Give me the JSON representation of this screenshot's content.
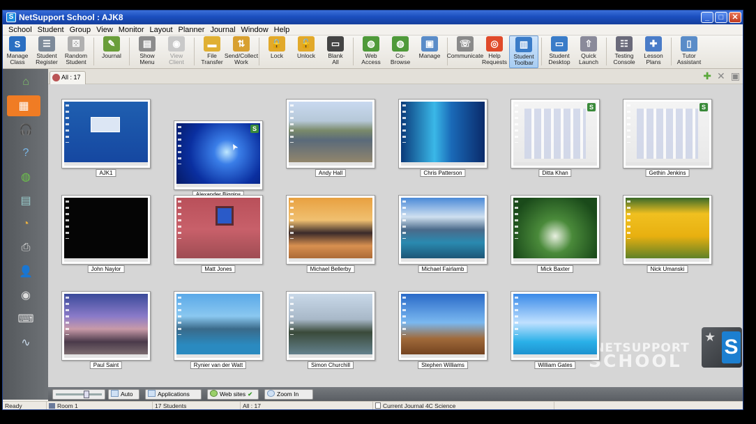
{
  "window": {
    "title": "NetSupport School : AJK8",
    "app_icon": "netsupport-app-icon"
  },
  "menu": [
    "School",
    "Student",
    "Group",
    "View",
    "Monitor",
    "Layout",
    "Planner",
    "Journal",
    "Window",
    "Help"
  ],
  "toolbar": [
    {
      "id": "manage-class",
      "label": "Manage\nClass",
      "icon": "manage-class-icon",
      "color": "#2b6fc2",
      "glyph": "S"
    },
    {
      "id": "student-register",
      "label": "Student\nRegister",
      "icon": "student-register-icon",
      "color": "#7d8a99",
      "glyph": "☰"
    },
    {
      "id": "random-student",
      "label": "Random\nStudent",
      "icon": "dice-icon",
      "color": "#b0b0b0",
      "glyph": "⚄"
    },
    {
      "sep": true
    },
    {
      "id": "journal",
      "label": "Journal",
      "icon": "journal-icon",
      "color": "#6a9e3a",
      "glyph": "✎"
    },
    {
      "sep": true
    },
    {
      "id": "show-menu",
      "label": "Show\nMenu",
      "icon": "show-menu-icon",
      "color": "#8c8c8c",
      "glyph": "▤"
    },
    {
      "id": "view-client",
      "label": "View\nClient",
      "icon": "view-client-icon",
      "color": "#c9c9c9",
      "glyph": "◉",
      "disabled": true
    },
    {
      "sep": true
    },
    {
      "id": "file-transfer",
      "label": "File\nTransfer",
      "icon": "folder-icon",
      "color": "#e0b033",
      "glyph": "▬"
    },
    {
      "id": "send-collect",
      "label": "Send/Collect\nWork",
      "icon": "send-collect-icon",
      "color": "#d8a030",
      "glyph": "⇅"
    },
    {
      "sep": true
    },
    {
      "id": "lock",
      "label": "Lock",
      "icon": "lock-icon",
      "color": "#e2a92a",
      "glyph": "🔒"
    },
    {
      "id": "unlock",
      "label": "Unlock",
      "icon": "unlock-icon",
      "color": "#e2a92a",
      "glyph": "🔓"
    },
    {
      "id": "blank-all",
      "label": "Blank\nAll",
      "icon": "monitor-icon",
      "color": "#444",
      "glyph": "▭"
    },
    {
      "sep": true
    },
    {
      "id": "web-access",
      "label": "Web\nAccess",
      "icon": "globe-icon",
      "color": "#4f9a3a",
      "glyph": "◍"
    },
    {
      "id": "co-browse",
      "label": "Co-Browse",
      "icon": "co-browse-icon",
      "color": "#4f9a3a",
      "glyph": "◍"
    },
    {
      "id": "manage",
      "label": "Manage",
      "icon": "manage-icon",
      "color": "#5a8cc8",
      "glyph": "▣"
    },
    {
      "sep": true
    },
    {
      "id": "communicate",
      "label": "Communicate",
      "icon": "communicate-icon",
      "color": "#8a8a8a",
      "glyph": "☏"
    },
    {
      "id": "help-requests",
      "label": "Help\nRequests",
      "icon": "lifebuoy-icon",
      "color": "#e04a2a",
      "glyph": "◎"
    },
    {
      "id": "student-toolbar",
      "label": "Student\nToolbar",
      "icon": "student-toolbar-icon",
      "color": "#3a7cc8",
      "glyph": "▥",
      "selected": true
    },
    {
      "sep": true
    },
    {
      "id": "student-desktop",
      "label": "Student\nDesktop",
      "icon": "student-desktop-icon",
      "color": "#3a7cc8",
      "glyph": "▭"
    },
    {
      "id": "quick-launch",
      "label": "Quick\nLaunch",
      "icon": "rocket-icon",
      "color": "#8a8a9a",
      "glyph": "⇧"
    },
    {
      "sep": true
    },
    {
      "id": "testing-console",
      "label": "Testing\nConsole",
      "icon": "testing-console-icon",
      "color": "#6a6a7a",
      "glyph": "☷"
    },
    {
      "id": "lesson-plans",
      "label": "Lesson\nPlans",
      "icon": "puzzle-icon",
      "color": "#4a7cc8",
      "glyph": "✚"
    },
    {
      "sep": true
    },
    {
      "id": "tutor-assistant",
      "label": "Tutor\nAssistant",
      "icon": "tutor-assistant-icon",
      "color": "#5a8cc8",
      "glyph": "▯"
    }
  ],
  "sidebar": [
    {
      "id": "home",
      "icon": "home-icon",
      "glyph": "⌂",
      "color": "#7ec26a"
    },
    {
      "id": "thumbnails",
      "icon": "thumbnail-view-icon",
      "glyph": "▦",
      "color": "#fff",
      "selected": true
    },
    {
      "id": "audio",
      "icon": "headphones-icon",
      "glyph": "🎧",
      "color": "#ddd"
    },
    {
      "id": "questions",
      "icon": "question-icon",
      "glyph": "?",
      "color": "#7ab8e8"
    },
    {
      "id": "web",
      "icon": "globe-icon",
      "glyph": "◍",
      "color": "#6cc24a"
    },
    {
      "id": "apps",
      "icon": "applications-icon",
      "glyph": "▤",
      "color": "#9cc"
    },
    {
      "id": "reports",
      "icon": "pie-chart-icon",
      "glyph": "◔",
      "color": "#e8b040"
    },
    {
      "id": "print",
      "icon": "printer-icon",
      "glyph": "⎙",
      "color": "#ddd"
    },
    {
      "id": "users",
      "icon": "users-icon",
      "glyph": "👤",
      "color": "#8cc"
    },
    {
      "id": "media",
      "icon": "media-icon",
      "glyph": "◉",
      "color": "#ddd"
    },
    {
      "id": "keyboard",
      "icon": "keyboard-icon",
      "glyph": "⌨",
      "color": "#ddd"
    },
    {
      "id": "activity",
      "icon": "activity-chart-icon",
      "glyph": "∿",
      "color": "#cde"
    }
  ],
  "tab": {
    "label": "All : 17"
  },
  "tabtools": [
    {
      "id": "add",
      "icon": "add-icon",
      "glyph": "✚",
      "color": "#5aa83a"
    },
    {
      "id": "close",
      "icon": "close-icon",
      "glyph": "✕",
      "color": "#888"
    },
    {
      "id": "window",
      "icon": "window-icon",
      "glyph": "▣",
      "color": "#888"
    }
  ],
  "students": [
    {
      "name": "AJK1",
      "bg": "linear-gradient(#1f5fb0,#1546a0)",
      "badge": false
    },
    {
      "name": "Alexander Biggins",
      "bg": "radial-gradient(circle at 60% 45%, #bfe8ff 0%, #3a7ee8 20%, #0a2fa0 60%, #051860 100%)",
      "badge": true
    },
    {
      "name": "Andy Hall",
      "bg": "linear-gradient(#c9d9f0 0%, #b6c8d8 30%, #7a8a6a 45%, #5a6a7a 60%, #9a8a6a 100%)",
      "badge": false
    },
    {
      "name": "Chris Patterson",
      "bg": "linear-gradient(90deg,#0a3a7a,#3ab8e8 40%,#1a6ab8 60%,#0a2a6a)",
      "badge": false
    },
    {
      "name": "Ditta Khan",
      "bg": "linear-gradient(#f4f4f4,#e8e8e8)",
      "badge": true
    },
    {
      "name": "Gethin Jenkins",
      "bg": "linear-gradient(#f4f4f4,#e8e8e8)",
      "badge": true
    },
    {
      "name": "John Naylor",
      "bg": "#050505",
      "badge": false
    },
    {
      "name": "Matt Jones",
      "bg": "linear-gradient(#b9505a,#c8606a 50%,#9a4a50)",
      "badge": false
    },
    {
      "name": "Michael Bellerby",
      "bg": "linear-gradient(#e8a040 0%,#f0c070 35%,#3a2a2a 55%,#d89050 75%,#a06030)",
      "badge": false
    },
    {
      "name": "Michael Fairlamb",
      "bg": "linear-gradient(#4a8ad8 0%,#cfe0f0 30%,#4a6a8a 50%,#2a8ab0 70%,#1a4a6a)",
      "badge": false
    },
    {
      "name": "Mick Baxter",
      "bg": "radial-gradient(circle at 50% 60%, #e8f0e0 0%, #4a8a3a 30%, #1a4a1a 80%)",
      "badge": false
    },
    {
      "name": "Nick Umanski",
      "bg": "linear-gradient(#3a6a2a 0%,#f0c020 25%,#e8b010 60%,#4a7a2a)",
      "badge": false
    },
    {
      "name": "Paul Saint",
      "bg": "linear-gradient(#3a4a9a 0%,#8a7ac8 35%,#c89aa8 55%,#4a3a4a 75%,#8a7a7a)",
      "badge": false
    },
    {
      "name": "Rynier van der Watt",
      "bg": "linear-gradient(#5aa8e8 0%,#8ac8f0 35%,#3a6a8a 55%,#2a8ac0 80%)",
      "badge": false
    },
    {
      "name": "Simon Churchill",
      "bg": "linear-gradient(#c8d8e8 0%,#a8b8c8 40%,#3a4a3a 60%,#6a8a9a 100%)",
      "badge": false
    },
    {
      "name": "Stephen Williams",
      "bg": "linear-gradient(#2a6ac8 0%,#7ab8f0 45%,#a06a3a 70%,#6a3a1a)",
      "badge": false
    },
    {
      "name": "William Gates",
      "bg": "linear-gradient(#3a8ae8 0%,#bfe0ff 45%,#2ab0e8 75%,#1a8ac8)",
      "badge": false
    }
  ],
  "brand": {
    "line1": "NETSUPPORT",
    "line2": "SCHOOL",
    "logo_letter": "S"
  },
  "controls": {
    "auto": "Auto",
    "applications": "Applications",
    "websites": "Web sites",
    "zoom_in": "Zoom In"
  },
  "status": {
    "ready": "Ready",
    "room": "Room 1",
    "students": "17 Students",
    "all": "All : 17",
    "journal": "Current Journal 4C Science"
  }
}
